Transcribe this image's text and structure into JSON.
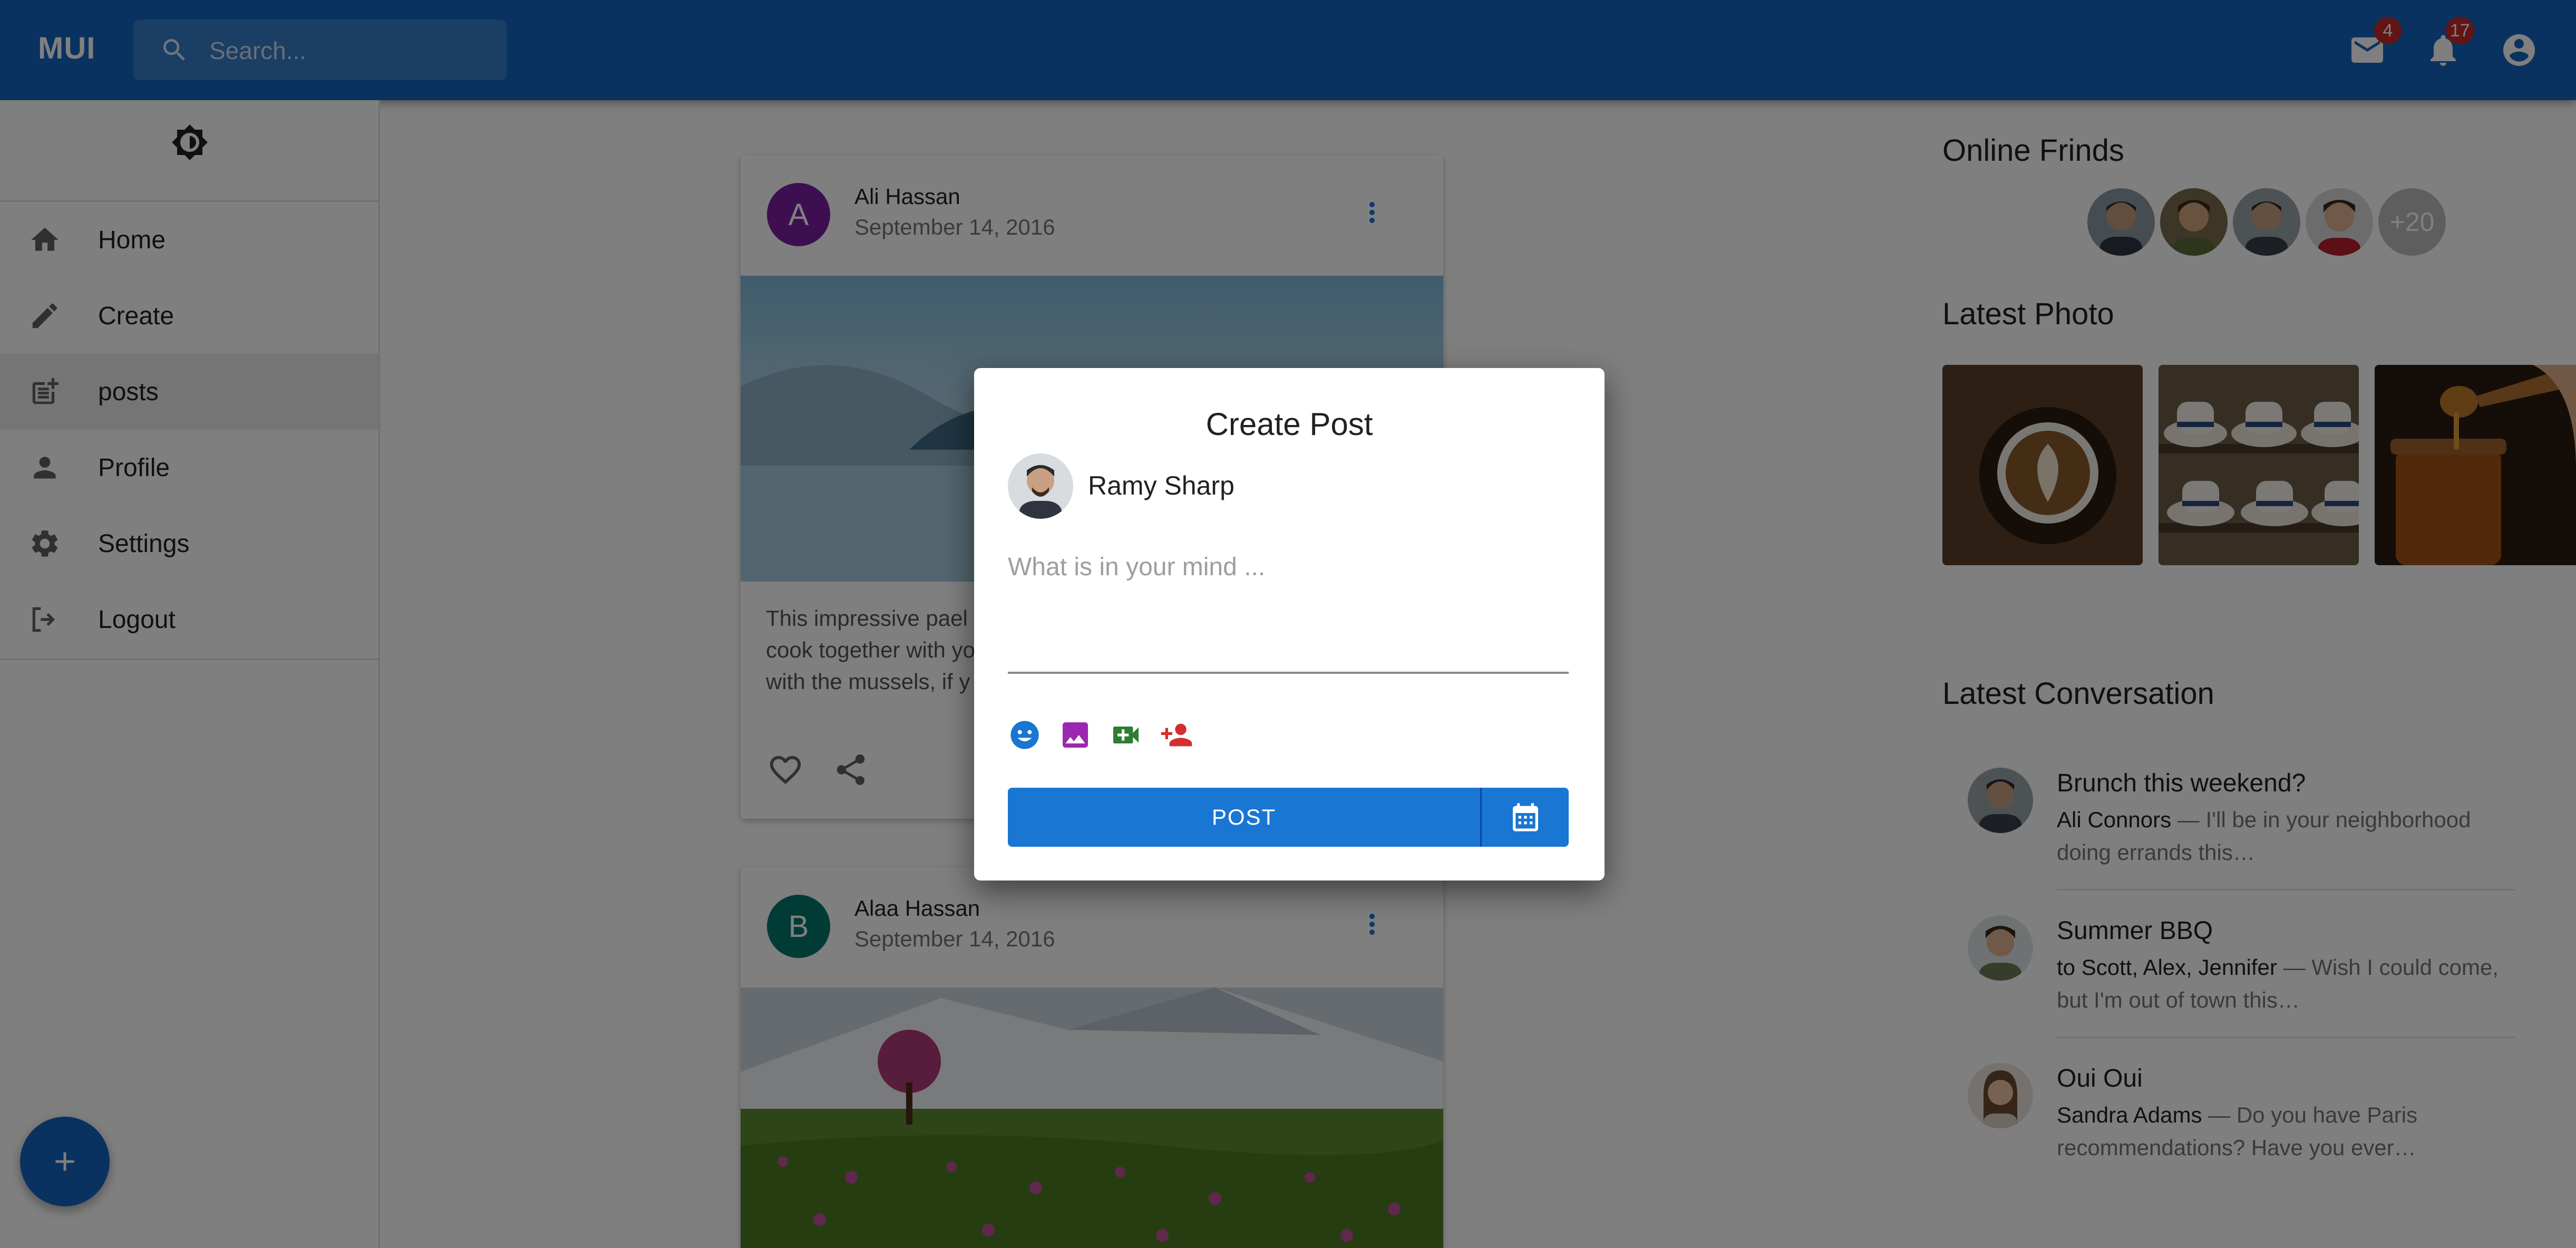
{
  "appbar": {
    "brand": "MUI",
    "search_placeholder": "Search...",
    "mail_badge": "4",
    "notifications_badge": "17"
  },
  "sidebar": {
    "items": [
      {
        "label": "Home",
        "icon": "home-icon"
      },
      {
        "label": "Create",
        "icon": "pencil-icon"
      },
      {
        "label": "posts",
        "icon": "post-add-icon",
        "selected": true
      },
      {
        "label": "Profile",
        "icon": "person-icon"
      },
      {
        "label": "Settings",
        "icon": "gear-icon"
      },
      {
        "label": "Logout",
        "icon": "logout-icon"
      }
    ],
    "fab_icon": "plus-icon"
  },
  "feed": {
    "posts": [
      {
        "avatar_letter": "A",
        "avatar_color": "#7b1fa2",
        "author": "Ali Hassan",
        "date": "September 14, 2016",
        "text_lines": [
          "This impressive pael",
          "cook together with yo",
          "with the mussels, if y"
        ]
      },
      {
        "avatar_letter": "B",
        "avatar_color": "#00796b",
        "author": "Alaa Hassan",
        "date": "September 14, 2016"
      }
    ]
  },
  "right": {
    "online_title": "Online Frinds",
    "more_friends": "+20",
    "latest_photo_title": "Latest Photo",
    "conversation_title": "Latest Conversation",
    "conversations": [
      {
        "title": "Brunch this weekend?",
        "from": "Ali Connors",
        "snippet": " — I'll be in your neighborhood doing errands this…"
      },
      {
        "title": "Summer BBQ",
        "from": "to Scott, Alex, Jennifer",
        "snippet": " — Wish I could come, but I'm out of town this…"
      },
      {
        "title": "Oui Oui",
        "from": "Sandra Adams",
        "snippet": " — Do you have Paris recommendations? Have you ever…"
      }
    ]
  },
  "modal": {
    "title": "Create Post",
    "user_name": "Ramy Sharp",
    "placeholder": "What is in your mind ...",
    "post_label": "POST",
    "tools": [
      "emoji-icon",
      "image-icon",
      "video-icon",
      "person-add-icon"
    ],
    "colors": {
      "accent": "#1976d2",
      "emoji": "#1976d2",
      "image": "#9c27b0",
      "video": "#2e7d32",
      "person_add": "#d32f2f"
    }
  }
}
